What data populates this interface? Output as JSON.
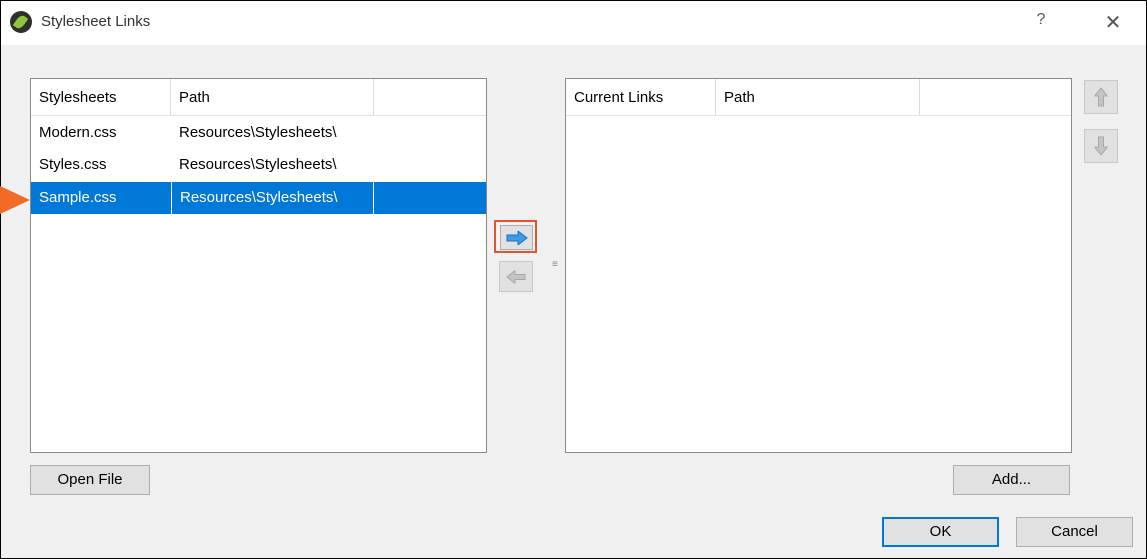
{
  "window": {
    "title": "Stylesheet Links",
    "help_glyph": "?",
    "close_glyph": "✕"
  },
  "stylesheets": {
    "columns": [
      "Stylesheets",
      "Path"
    ],
    "rows": [
      {
        "name": "Modern.css",
        "path": "Resources\\Stylesheets\\"
      },
      {
        "name": "Styles.css",
        "path": "Resources\\Stylesheets\\"
      },
      {
        "name": "Sample.css",
        "path": "Resources\\Stylesheets\\",
        "selected": true
      }
    ]
  },
  "current_links": {
    "columns": [
      "Current Links",
      "Path"
    ],
    "rows": []
  },
  "buttons": {
    "open_file": "Open File",
    "add": "Add...",
    "ok": "OK",
    "cancel": "Cancel"
  },
  "colors": {
    "selection": "#0078d7",
    "highlight_box": "#e2562d",
    "callout_arrow": "#f26b24",
    "move_arrow": "#3c9be8"
  }
}
